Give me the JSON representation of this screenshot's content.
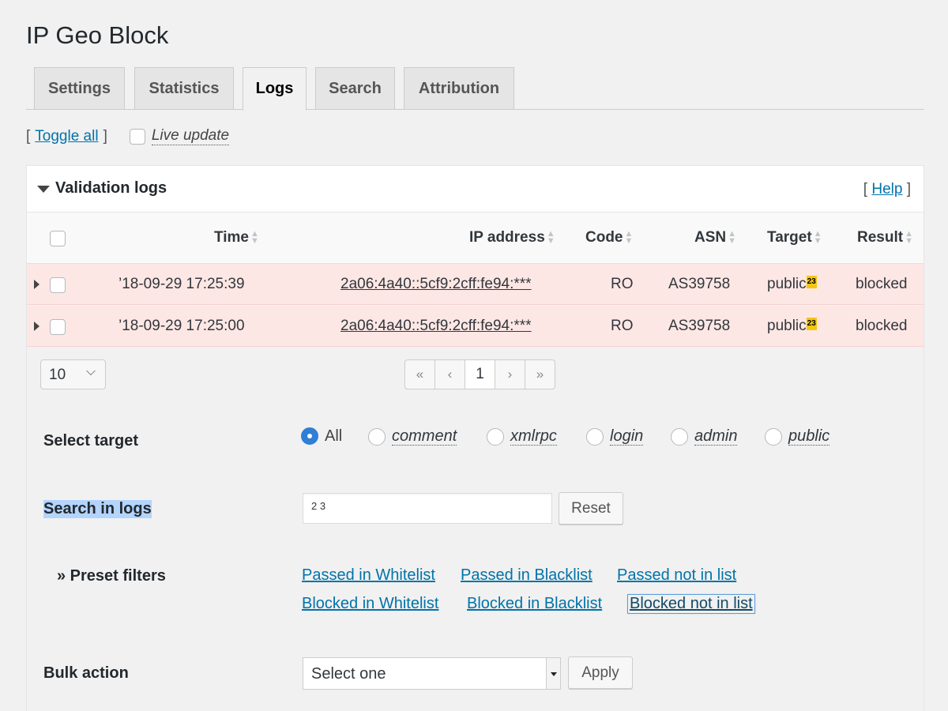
{
  "app": {
    "title": "IP Geo Block"
  },
  "tabs": [
    {
      "label": "Settings",
      "active": false
    },
    {
      "label": "Statistics",
      "active": false
    },
    {
      "label": "Logs",
      "active": true
    },
    {
      "label": "Search",
      "active": false
    },
    {
      "label": "Attribution",
      "active": false
    }
  ],
  "toolbar": {
    "bracket_open": "[",
    "toggle_all": "Toggle all",
    "bracket_close": "]",
    "live_update": "Live update",
    "live_update_checked": false
  },
  "panel": {
    "title": "Validation logs",
    "help_open": "[",
    "help_label": "Help",
    "help_close": "]"
  },
  "table": {
    "columns": [
      "Time",
      "IP address",
      "Code",
      "ASN",
      "Target",
      "Result"
    ],
    "rows": [
      {
        "time": "’18-09-29 17:25:39",
        "ip": "2a06:4a40::5cf9:2cff:fe94:***",
        "code": "RO",
        "asn": "AS39758",
        "target": "public",
        "target_badge": "23",
        "result": "blocked"
      },
      {
        "time": "’18-09-29 17:25:00",
        "ip": "2a06:4a40::5cf9:2cff:fe94:***",
        "code": "RO",
        "asn": "AS39758",
        "target": "public",
        "target_badge": "23",
        "result": "blocked"
      }
    ],
    "row_background": "#fde7e5"
  },
  "pagination": {
    "per_page": "10",
    "first": "«",
    "prev": "‹",
    "current": "1",
    "next": "›",
    "last": "»"
  },
  "filters": {
    "select_target_label": "Select target",
    "targets": [
      {
        "label": "All",
        "selected": true
      },
      {
        "label": "comment",
        "selected": false
      },
      {
        "label": "xmlrpc",
        "selected": false
      },
      {
        "label": "login",
        "selected": false
      },
      {
        "label": "admin",
        "selected": false
      },
      {
        "label": "public",
        "selected": false
      }
    ],
    "search_label": "Search in logs",
    "search_value": "2 3",
    "reset_label": "Reset",
    "preset_label": "» Preset filters",
    "presets": [
      "Passed in Whitelist",
      "Passed in Blacklist",
      "Passed not in list",
      "Blocked in Whitelist",
      "Blocked in Blacklist",
      "Blocked not in list"
    ],
    "bulk_label": "Bulk action",
    "bulk_selected": "Select one",
    "apply_label": "Apply"
  },
  "colors": {
    "link": "#0073aa",
    "accent_radio": "#2f7fd6",
    "badge": "#f5c60f",
    "blocked_row": "#fde7e5"
  }
}
